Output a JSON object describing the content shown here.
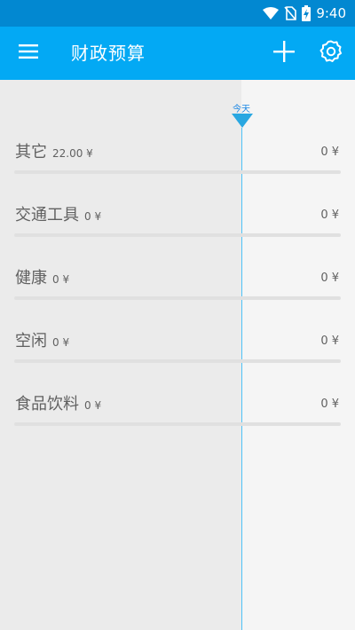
{
  "status_bar": {
    "time": "9:40"
  },
  "app_bar": {
    "title": "财政预算"
  },
  "timeline": {
    "today_label": "今天"
  },
  "categories": [
    {
      "name": "其它",
      "spent": "22.00 ¥",
      "budget": "0 ¥"
    },
    {
      "name": "交通工具",
      "spent": "0 ¥",
      "budget": "0 ¥"
    },
    {
      "name": "健康",
      "spent": "0 ¥",
      "budget": "0 ¥"
    },
    {
      "name": "空闲",
      "spent": "0 ¥",
      "budget": "0 ¥"
    },
    {
      "name": "食品饮料",
      "spent": "0 ¥",
      "budget": "0 ¥"
    }
  ],
  "colors": {
    "status_bar": "#0288d1",
    "app_bar": "#03a9f4",
    "today_marker": "#29a7e1"
  },
  "icons": [
    "wifi-icon",
    "no-sim-icon",
    "battery-charging-icon",
    "menu-icon",
    "add-icon",
    "settings-icon"
  ]
}
